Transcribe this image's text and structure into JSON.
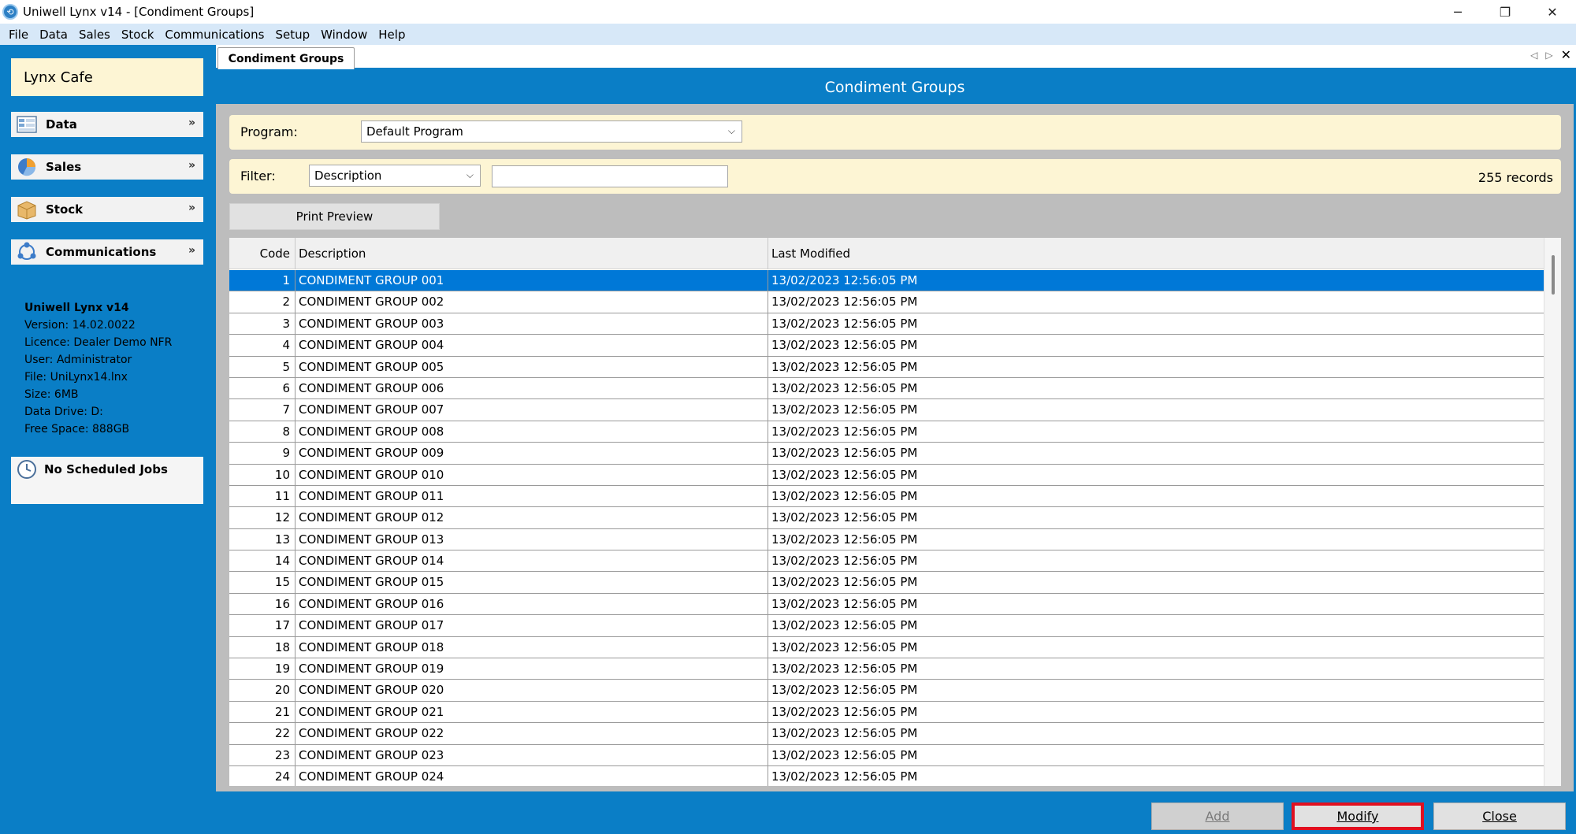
{
  "window": {
    "title": "Uniwell Lynx v14 - [Condiment Groups]",
    "controls": [
      "─",
      "❐",
      "✕"
    ]
  },
  "menu": [
    "File",
    "Data",
    "Sales",
    "Stock",
    "Communications",
    "Setup",
    "Window",
    "Help"
  ],
  "sidebar": {
    "company": "Lynx Cafe",
    "sections": [
      {
        "label": "Data",
        "icon": "data-icon"
      },
      {
        "label": "Sales",
        "icon": "sales-pie-icon"
      },
      {
        "label": "Stock",
        "icon": "stock-box-icon"
      },
      {
        "label": "Communications",
        "icon": "communications-icon"
      }
    ],
    "info": {
      "product": "Uniwell Lynx v14",
      "version": "Version: 14.02.0022",
      "licence": "Licence: Dealer Demo NFR",
      "user": "User: Administrator",
      "file": "File: UniLynx14.lnx",
      "size": "Size: 6MB",
      "drive": "Data Drive: D:",
      "free": "Free Space: 888GB"
    },
    "jobs": "No Scheduled Jobs"
  },
  "tab": {
    "label": "Condiment Groups"
  },
  "main": {
    "header": "Condiment Groups",
    "program_label": "Program:",
    "program_value": "Default Program",
    "filter_label": "Filter:",
    "filter_field": "Description",
    "filter_text": "",
    "records": "255 records",
    "print_preview": "Print Preview"
  },
  "grid": {
    "columns": [
      "Code",
      "Description",
      "Last Modified"
    ],
    "selected_index": 0,
    "rows": [
      [
        "1",
        "CONDIMENT GROUP 001",
        "13/02/2023 12:56:05 PM"
      ],
      [
        "2",
        "CONDIMENT GROUP 002",
        "13/02/2023 12:56:05 PM"
      ],
      [
        "3",
        "CONDIMENT GROUP 003",
        "13/02/2023 12:56:05 PM"
      ],
      [
        "4",
        "CONDIMENT GROUP 004",
        "13/02/2023 12:56:05 PM"
      ],
      [
        "5",
        "CONDIMENT GROUP 005",
        "13/02/2023 12:56:05 PM"
      ],
      [
        "6",
        "CONDIMENT GROUP 006",
        "13/02/2023 12:56:05 PM"
      ],
      [
        "7",
        "CONDIMENT GROUP 007",
        "13/02/2023 12:56:05 PM"
      ],
      [
        "8",
        "CONDIMENT GROUP 008",
        "13/02/2023 12:56:05 PM"
      ],
      [
        "9",
        "CONDIMENT GROUP 009",
        "13/02/2023 12:56:05 PM"
      ],
      [
        "10",
        "CONDIMENT GROUP 010",
        "13/02/2023 12:56:05 PM"
      ],
      [
        "11",
        "CONDIMENT GROUP 011",
        "13/02/2023 12:56:05 PM"
      ],
      [
        "12",
        "CONDIMENT GROUP 012",
        "13/02/2023 12:56:05 PM"
      ],
      [
        "13",
        "CONDIMENT GROUP 013",
        "13/02/2023 12:56:05 PM"
      ],
      [
        "14",
        "CONDIMENT GROUP 014",
        "13/02/2023 12:56:05 PM"
      ],
      [
        "15",
        "CONDIMENT GROUP 015",
        "13/02/2023 12:56:05 PM"
      ],
      [
        "16",
        "CONDIMENT GROUP 016",
        "13/02/2023 12:56:05 PM"
      ],
      [
        "17",
        "CONDIMENT GROUP 017",
        "13/02/2023 12:56:05 PM"
      ],
      [
        "18",
        "CONDIMENT GROUP 018",
        "13/02/2023 12:56:05 PM"
      ],
      [
        "19",
        "CONDIMENT GROUP 019",
        "13/02/2023 12:56:05 PM"
      ],
      [
        "20",
        "CONDIMENT GROUP 020",
        "13/02/2023 12:56:05 PM"
      ],
      [
        "21",
        "CONDIMENT GROUP 021",
        "13/02/2023 12:56:05 PM"
      ],
      [
        "22",
        "CONDIMENT GROUP 022",
        "13/02/2023 12:56:05 PM"
      ],
      [
        "23",
        "CONDIMENT GROUP 023",
        "13/02/2023 12:56:05 PM"
      ],
      [
        "24",
        "CONDIMENT GROUP 024",
        "13/02/2023 12:56:05 PM"
      ]
    ]
  },
  "buttons": {
    "add": "Add",
    "modify": "Modify",
    "close": "Close"
  },
  "colors": {
    "accent": "#0a7ec6",
    "selected_row": "#0078d7",
    "panel_cream": "#fdf5d4",
    "highlight_border": "#e01020"
  }
}
